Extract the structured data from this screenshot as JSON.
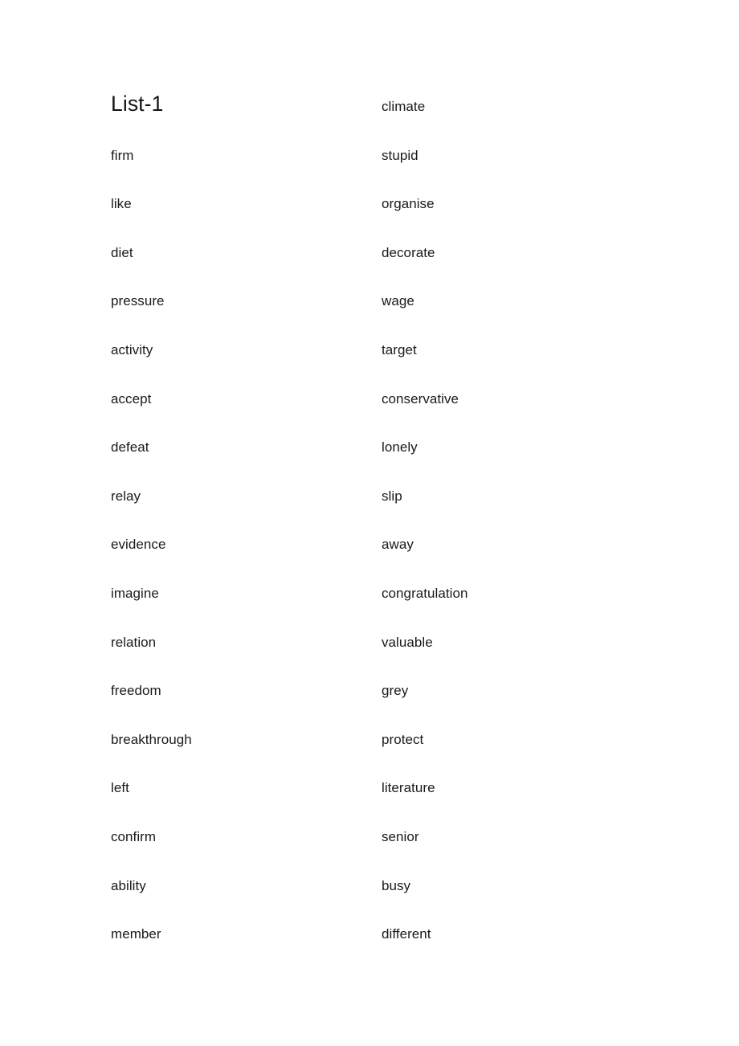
{
  "document": {
    "title": "List-1",
    "background_color": "#ffffff",
    "text_color": "#1a1a1a"
  },
  "columns": {
    "left": {
      "heading": "List-1",
      "words": [
        "firm",
        "like",
        "diet",
        "pressure",
        "activity",
        "accept",
        "defeat",
        "relay",
        "evidence",
        "imagine",
        "relation",
        "freedom",
        "breakthrough",
        "left",
        "confirm",
        "ability",
        "member"
      ]
    },
    "right": {
      "words": [
        "climate",
        "stupid",
        "organise",
        "decorate",
        "wage",
        "target",
        "conservative",
        "lonely",
        "slip",
        "away",
        "congratulation",
        "valuable",
        "grey",
        "protect",
        "literature",
        "senior",
        "busy",
        "different"
      ]
    }
  }
}
